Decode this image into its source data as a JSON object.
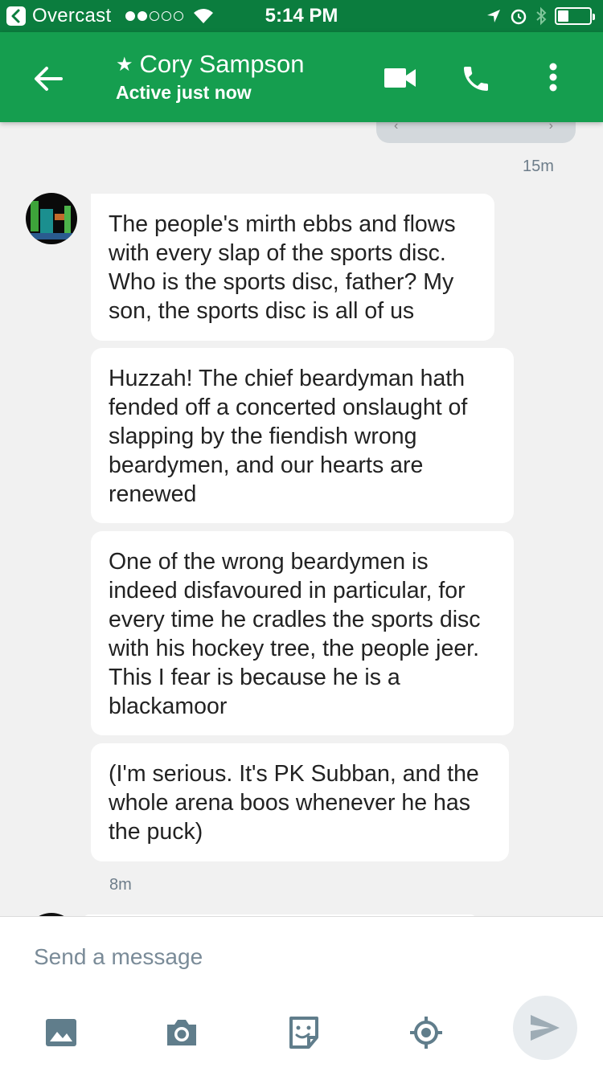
{
  "status_bar": {
    "carrier": "Overcast",
    "time": "5:14 PM",
    "signal_strength": 2,
    "battery_level": 0.35
  },
  "header": {
    "title": "Cory Sampson",
    "subtitle": "Active just now",
    "starred": true
  },
  "conversation": {
    "timestamp_top": "15m",
    "messages": [
      "The people's mirth ebbs and flows with every slap of the sports disc. Who is the sports disc, father? My son, the sports disc is all of us",
      "Huzzah! The chief beardyman hath fended off a concerted onslaught of slapping by the fiendish wrong beardymen, and our hearts are renewed",
      "One of the wrong beardymen is indeed disfavoured in particular, for every time he cradles the sports disc with his hockey tree, the people jeer. This I fear is because he is a blackamoor",
      "(I'm serious. It's PK Subban, and the whole arena boos whenever he has the puck)"
    ],
    "timestamp_bottom": "8m"
  },
  "composer": {
    "placeholder": "Send a message"
  },
  "colors": {
    "status_bar": "#0b7d3e",
    "app_bar": "#159e4f",
    "background": "#f1f1f1",
    "icon": "#607d8b"
  }
}
